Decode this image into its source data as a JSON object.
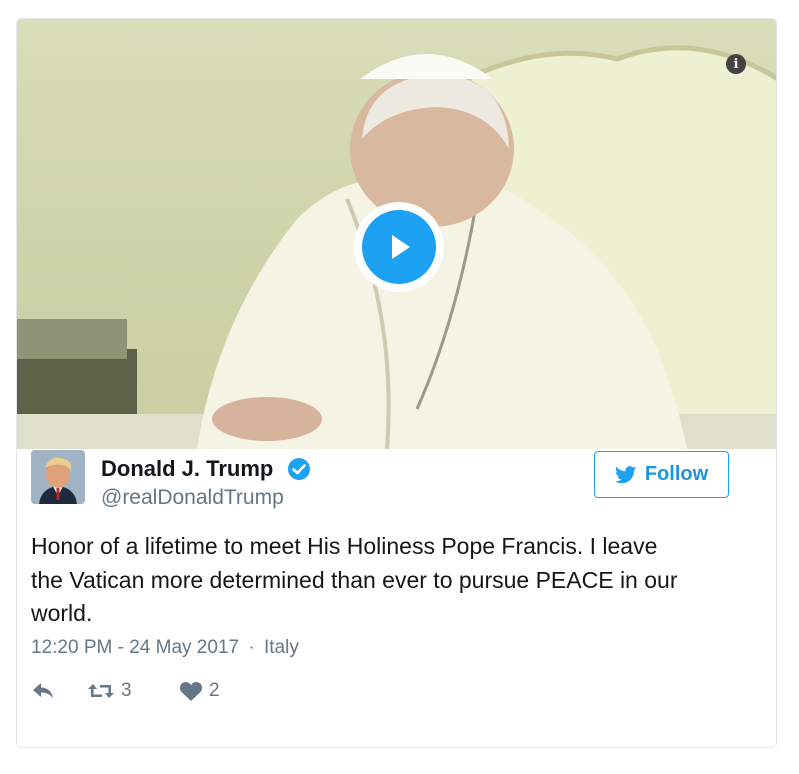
{
  "media": {
    "type": "video",
    "play_icon": "play-icon",
    "info_icon": "info-icon",
    "info_glyph": "i"
  },
  "author": {
    "name": "Donald J. Trump",
    "handle": "@realDonaldTrump",
    "verified_icon": "verified-badge-icon"
  },
  "follow_button": {
    "label": "Follow",
    "icon": "twitter-bird-icon"
  },
  "tweet": {
    "lines": [
      "Honor of a lifetime to meet His Holiness Pope Francis. I leave",
      "the Vatican more determined than ever to pursue PEACE in our",
      "world."
    ]
  },
  "meta": {
    "time": "12:20 PM",
    "separator": "-",
    "date": "24 May 2017",
    "dot": "·",
    "location": "Italy"
  },
  "actions": {
    "reply_icon": "reply-icon",
    "retweet_icon": "retweet-icon",
    "retweet_count": "3",
    "like_icon": "heart-icon",
    "like_count": "2"
  },
  "colors": {
    "accent": "#1da1f2",
    "text": "#14171a",
    "muted": "#657786",
    "border": "#e1e8ed"
  }
}
